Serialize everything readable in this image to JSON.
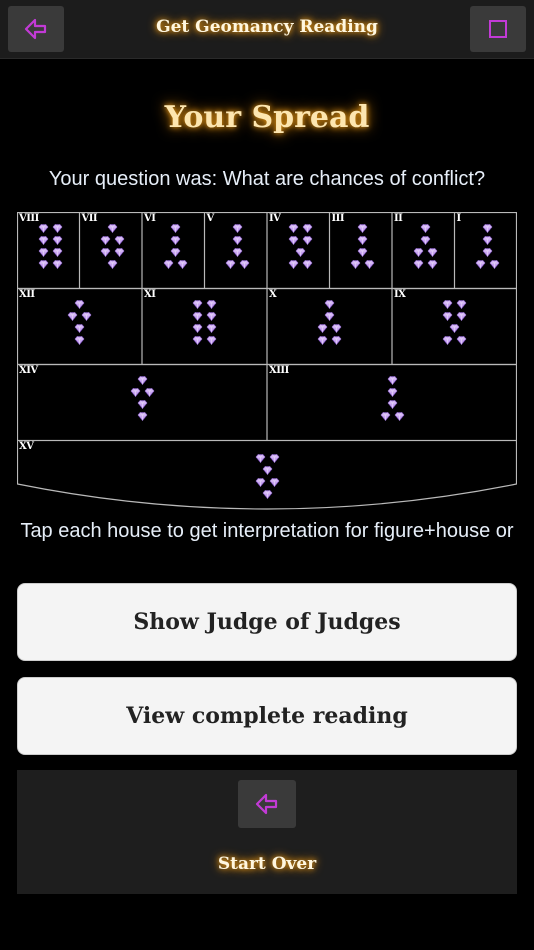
{
  "header": {
    "title": "Get Geomancy Reading",
    "back_icon": "arrow-left-icon",
    "menu_icon": "square-icon",
    "accent": "#c23ad6"
  },
  "main": {
    "heading": "Your Spread",
    "question": "Your question was: What are chances of conflict?",
    "hint": "Tap each house to get interpretation for figure+house or"
  },
  "houses": [
    {
      "label": "VIII",
      "figure": [
        2,
        2,
        2,
        2
      ]
    },
    {
      "label": "VII",
      "figure": [
        1,
        2,
        2,
        1
      ]
    },
    {
      "label": "VI",
      "figure": [
        1,
        1,
        1,
        2
      ]
    },
    {
      "label": "V",
      "figure": [
        1,
        1,
        1,
        2
      ]
    },
    {
      "label": "IV",
      "figure": [
        2,
        2,
        1,
        2
      ]
    },
    {
      "label": "III",
      "figure": [
        1,
        1,
        1,
        2
      ]
    },
    {
      "label": "II",
      "figure": [
        1,
        1,
        2,
        2
      ]
    },
    {
      "label": "I",
      "figure": [
        1,
        1,
        1,
        2
      ]
    },
    {
      "label": "XII",
      "figure": [
        1,
        2,
        1,
        1
      ]
    },
    {
      "label": "XI",
      "figure": [
        2,
        2,
        2,
        2
      ]
    },
    {
      "label": "X",
      "figure": [
        1,
        1,
        2,
        2
      ]
    },
    {
      "label": "IX",
      "figure": [
        2,
        2,
        1,
        2
      ]
    },
    {
      "label": "XIV",
      "figure": [
        1,
        2,
        1,
        1
      ]
    },
    {
      "label": "XIII",
      "figure": [
        1,
        1,
        1,
        2
      ]
    },
    {
      "label": "XV",
      "figure": [
        2,
        1,
        2,
        1
      ]
    }
  ],
  "buttons": {
    "judge": "Show Judge of Judges",
    "reading": "View complete reading",
    "start_over": "Start Over"
  },
  "colors": {
    "gem_light": "#f2e6ff",
    "gem_mid": "#c9a6f0",
    "gem_dark": "#7d4fc4",
    "glow": "#f3a11c",
    "grid": "#b9b9b9"
  }
}
